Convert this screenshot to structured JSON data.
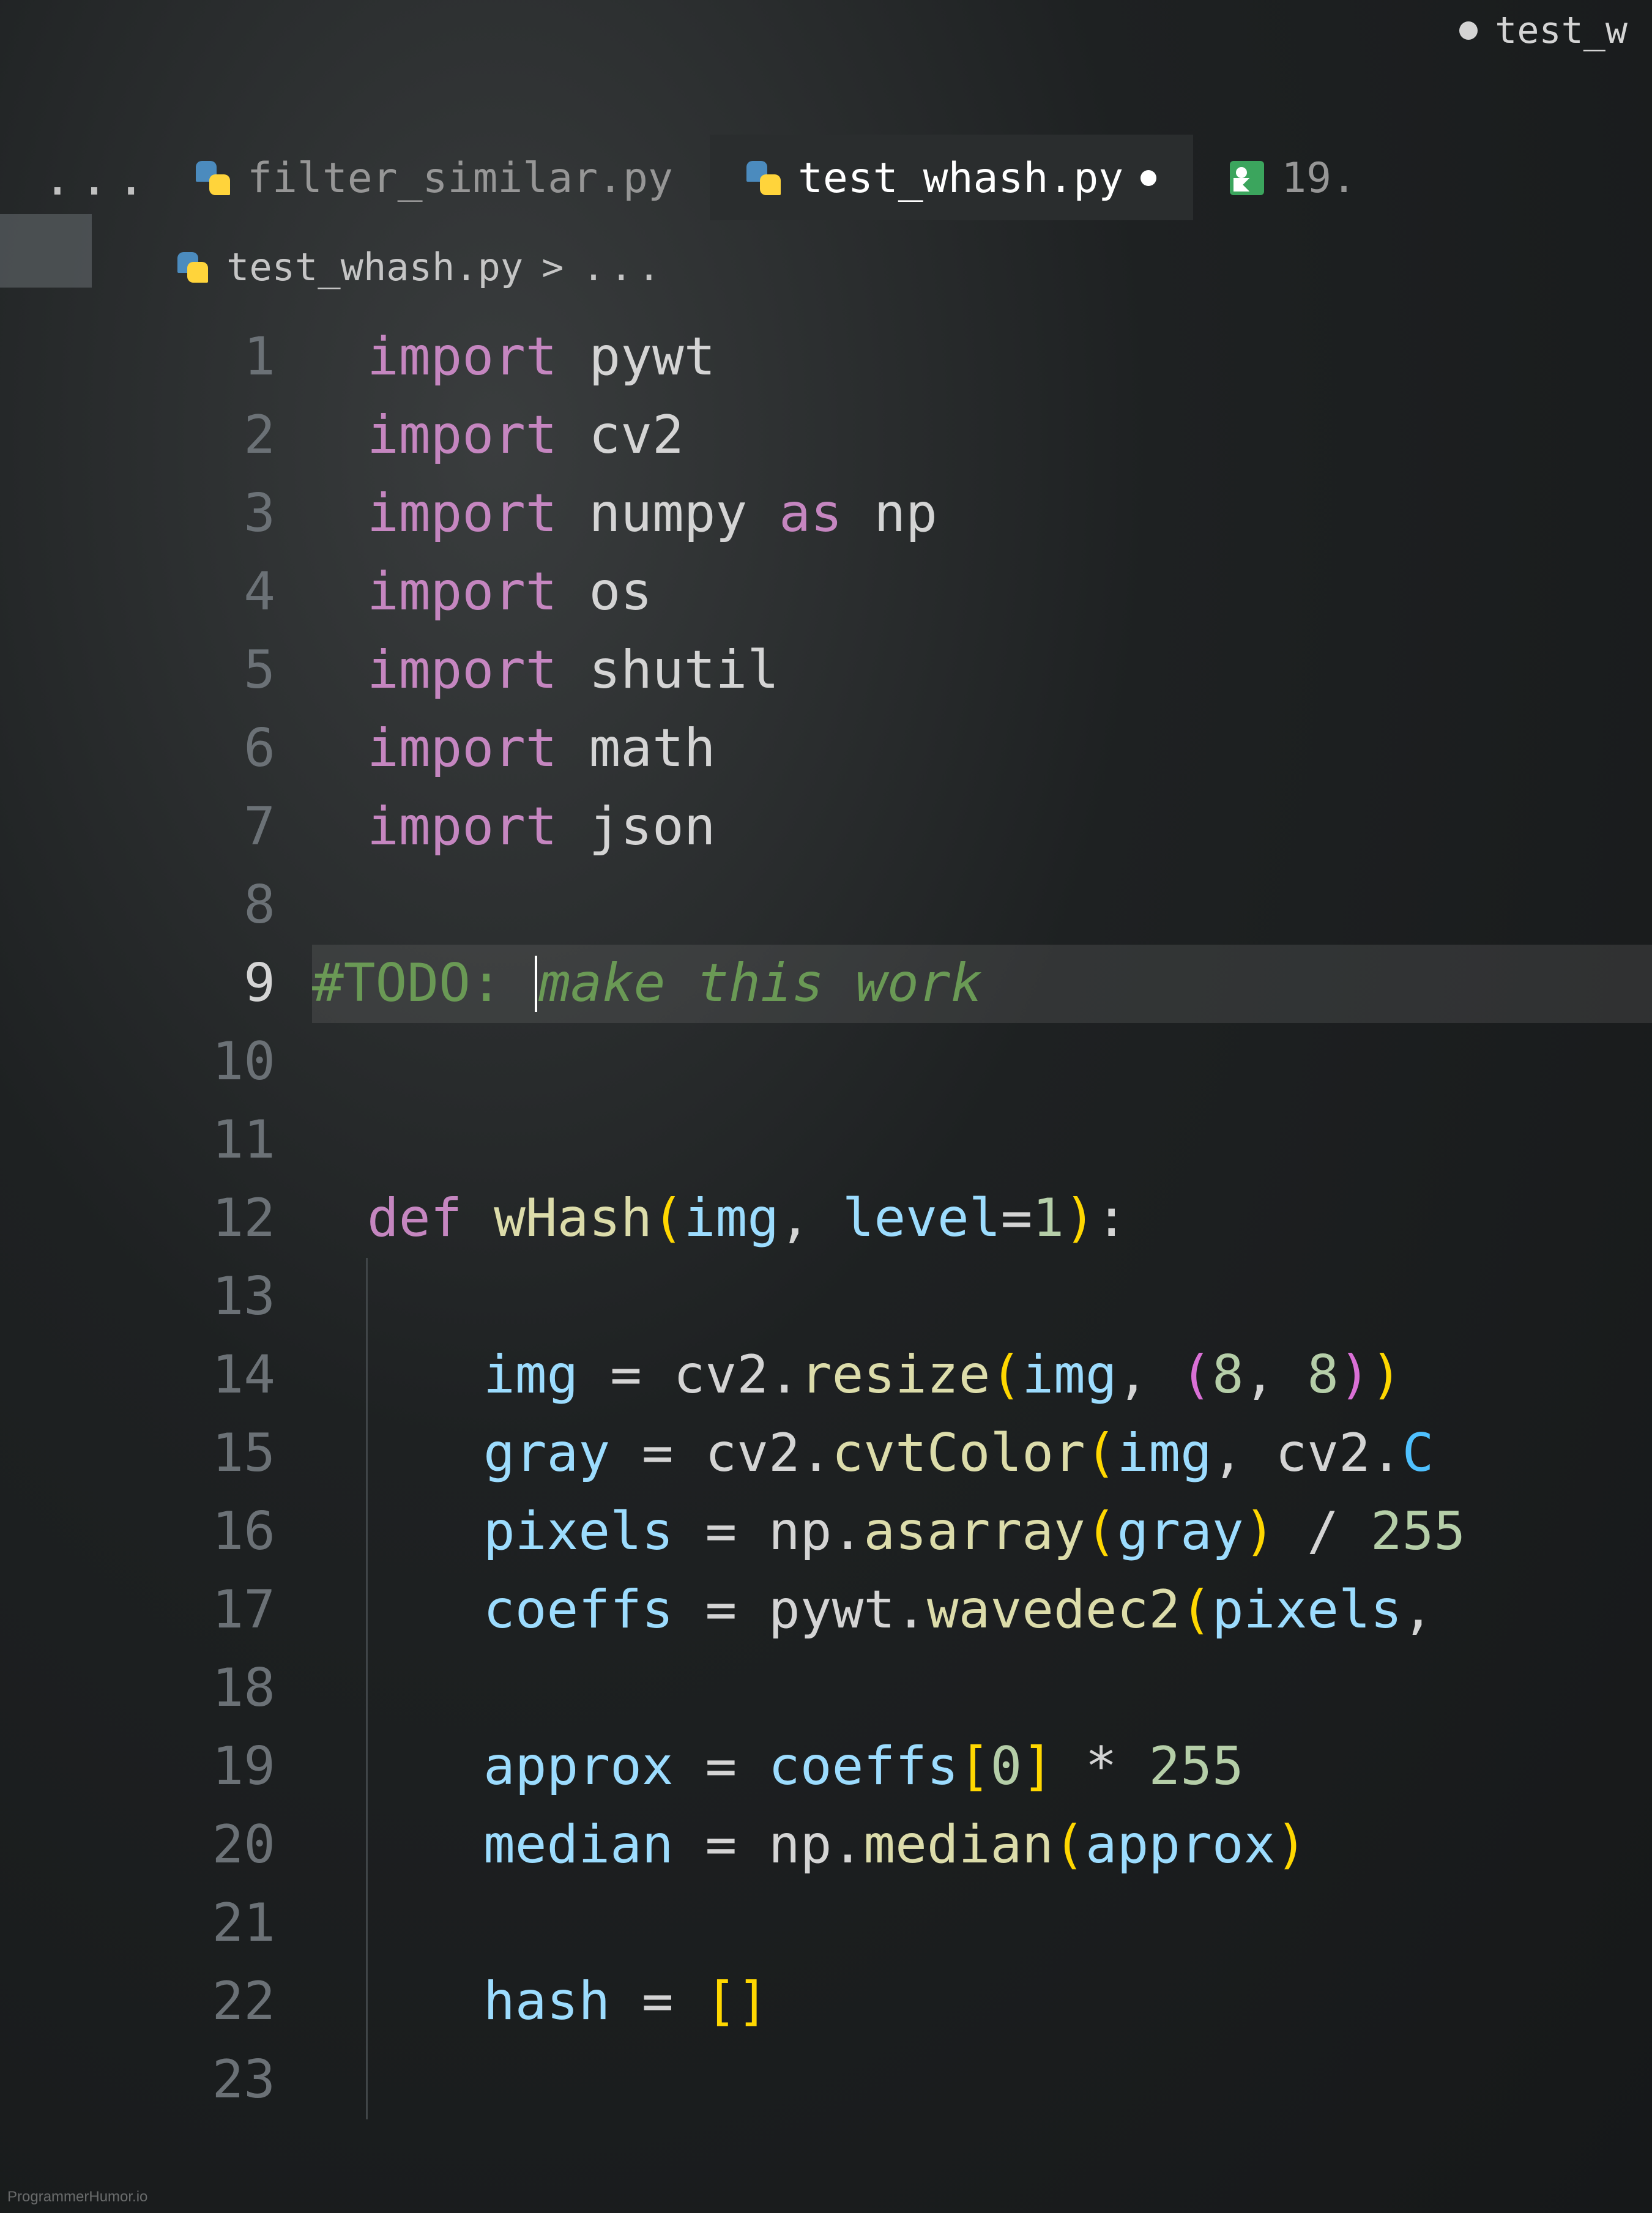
{
  "window_title_fragment": "test_w",
  "tabs": {
    "ellipsis": "...",
    "items": [
      {
        "label": "filter_similar.py",
        "icon": "python-file-icon",
        "active": false,
        "modified": false
      },
      {
        "label": "test_whash.py",
        "icon": "python-file-icon",
        "active": true,
        "modified": true
      },
      {
        "label": "19.",
        "icon": "image-file-icon",
        "active": false,
        "modified": false
      }
    ]
  },
  "breadcrumb": {
    "icon": "python-file-icon",
    "file": "test_whash.py",
    "chevron": ">",
    "rest": "..."
  },
  "editor": {
    "current_line": 9,
    "lines": [
      {
        "n": 1,
        "tokens": [
          [
            "kw",
            "import "
          ],
          [
            "id",
            "pywt"
          ]
        ]
      },
      {
        "n": 2,
        "tokens": [
          [
            "kw",
            "import "
          ],
          [
            "id",
            "cv2"
          ]
        ]
      },
      {
        "n": 3,
        "tokens": [
          [
            "kw",
            "import "
          ],
          [
            "id",
            "numpy"
          ],
          [
            "op",
            " "
          ],
          [
            "kw",
            "as"
          ],
          [
            "op",
            " "
          ],
          [
            "id",
            "np"
          ]
        ]
      },
      {
        "n": 4,
        "tokens": [
          [
            "kw",
            "import "
          ],
          [
            "id",
            "os"
          ]
        ]
      },
      {
        "n": 5,
        "tokens": [
          [
            "kw",
            "import "
          ],
          [
            "id",
            "shutil"
          ]
        ]
      },
      {
        "n": 6,
        "tokens": [
          [
            "kw",
            "import "
          ],
          [
            "id",
            "math"
          ]
        ]
      },
      {
        "n": 7,
        "tokens": [
          [
            "kw",
            "import "
          ],
          [
            "id",
            "json"
          ]
        ]
      },
      {
        "n": 8,
        "tokens": []
      },
      {
        "n": 9,
        "tokens": [
          [
            "cm",
            "#TODO: "
          ],
          [
            "cursor",
            ""
          ],
          [
            "cm-ital",
            "make this work"
          ]
        ],
        "highlight": true
      },
      {
        "n": 10,
        "tokens": []
      },
      {
        "n": 11,
        "tokens": []
      },
      {
        "n": 12,
        "tokens": [
          [
            "kw",
            "def "
          ],
          [
            "fn",
            "wHash"
          ],
          [
            "brk1",
            "("
          ],
          [
            "param",
            "img"
          ],
          [
            "pn",
            ", "
          ],
          [
            "param",
            "level"
          ],
          [
            "op",
            "="
          ],
          [
            "num",
            "1"
          ],
          [
            "brk1",
            ")"
          ],
          [
            "pn",
            ":"
          ]
        ]
      },
      {
        "n": 13,
        "indent": 1,
        "tokens": []
      },
      {
        "n": 14,
        "indent": 1,
        "tokens": [
          [
            "var",
            "img"
          ],
          [
            "op",
            " = "
          ],
          [
            "id",
            "cv2"
          ],
          [
            "pn",
            "."
          ],
          [
            "fn",
            "resize"
          ],
          [
            "brk1",
            "("
          ],
          [
            "var",
            "img"
          ],
          [
            "pn",
            ", "
          ],
          [
            "brk2",
            "("
          ],
          [
            "num",
            "8"
          ],
          [
            "pn",
            ", "
          ],
          [
            "num",
            "8"
          ],
          [
            "brk2",
            ")"
          ],
          [
            "brk1",
            ")"
          ]
        ]
      },
      {
        "n": 15,
        "indent": 1,
        "tokens": [
          [
            "var",
            "gray"
          ],
          [
            "op",
            " = "
          ],
          [
            "id",
            "cv2"
          ],
          [
            "pn",
            "."
          ],
          [
            "fn",
            "cvtColor"
          ],
          [
            "brk1",
            "("
          ],
          [
            "var",
            "img"
          ],
          [
            "pn",
            ", "
          ],
          [
            "id",
            "cv2"
          ],
          [
            "pn",
            "."
          ],
          [
            "const",
            "C"
          ]
        ]
      },
      {
        "n": 16,
        "indent": 1,
        "tokens": [
          [
            "var",
            "pixels"
          ],
          [
            "op",
            " = "
          ],
          [
            "id",
            "np"
          ],
          [
            "pn",
            "."
          ],
          [
            "fn",
            "asarray"
          ],
          [
            "brk1",
            "("
          ],
          [
            "var",
            "gray"
          ],
          [
            "brk1",
            ")"
          ],
          [
            "op",
            " / "
          ],
          [
            "num",
            "255"
          ]
        ]
      },
      {
        "n": 17,
        "indent": 1,
        "tokens": [
          [
            "var",
            "coeffs"
          ],
          [
            "op",
            " = "
          ],
          [
            "id",
            "pywt"
          ],
          [
            "pn",
            "."
          ],
          [
            "fn",
            "wavedec2"
          ],
          [
            "brk1",
            "("
          ],
          [
            "var",
            "pixels"
          ],
          [
            "pn",
            ","
          ]
        ]
      },
      {
        "n": 18,
        "indent": 1,
        "tokens": []
      },
      {
        "n": 19,
        "indent": 1,
        "tokens": [
          [
            "var",
            "approx"
          ],
          [
            "op",
            " = "
          ],
          [
            "var",
            "coeffs"
          ],
          [
            "brk1",
            "["
          ],
          [
            "num",
            "0"
          ],
          [
            "brk1",
            "]"
          ],
          [
            "op",
            " * "
          ],
          [
            "num",
            "255"
          ]
        ]
      },
      {
        "n": 20,
        "indent": 1,
        "tokens": [
          [
            "var",
            "median"
          ],
          [
            "op",
            " = "
          ],
          [
            "id",
            "np"
          ],
          [
            "pn",
            "."
          ],
          [
            "fn",
            "median"
          ],
          [
            "brk1",
            "("
          ],
          [
            "var",
            "approx"
          ],
          [
            "brk1",
            ")"
          ]
        ]
      },
      {
        "n": 21,
        "indent": 1,
        "tokens": []
      },
      {
        "n": 22,
        "indent": 1,
        "tokens": [
          [
            "var",
            "hash"
          ],
          [
            "op",
            " = "
          ],
          [
            "brk1",
            "["
          ],
          [
            "brk1",
            "]"
          ]
        ]
      },
      {
        "n": 23,
        "indent": 1,
        "tokens": []
      }
    ]
  },
  "watermark": "ProgrammerHumor.io",
  "colors": {
    "background": "#1e1e1e",
    "keyword": "#c586c0",
    "function": "#dcdcaa",
    "variable": "#9cdcfe",
    "number": "#b5cea8",
    "comment": "#6a9955",
    "bracket1": "#ffd700",
    "bracket2": "#da70d6"
  }
}
